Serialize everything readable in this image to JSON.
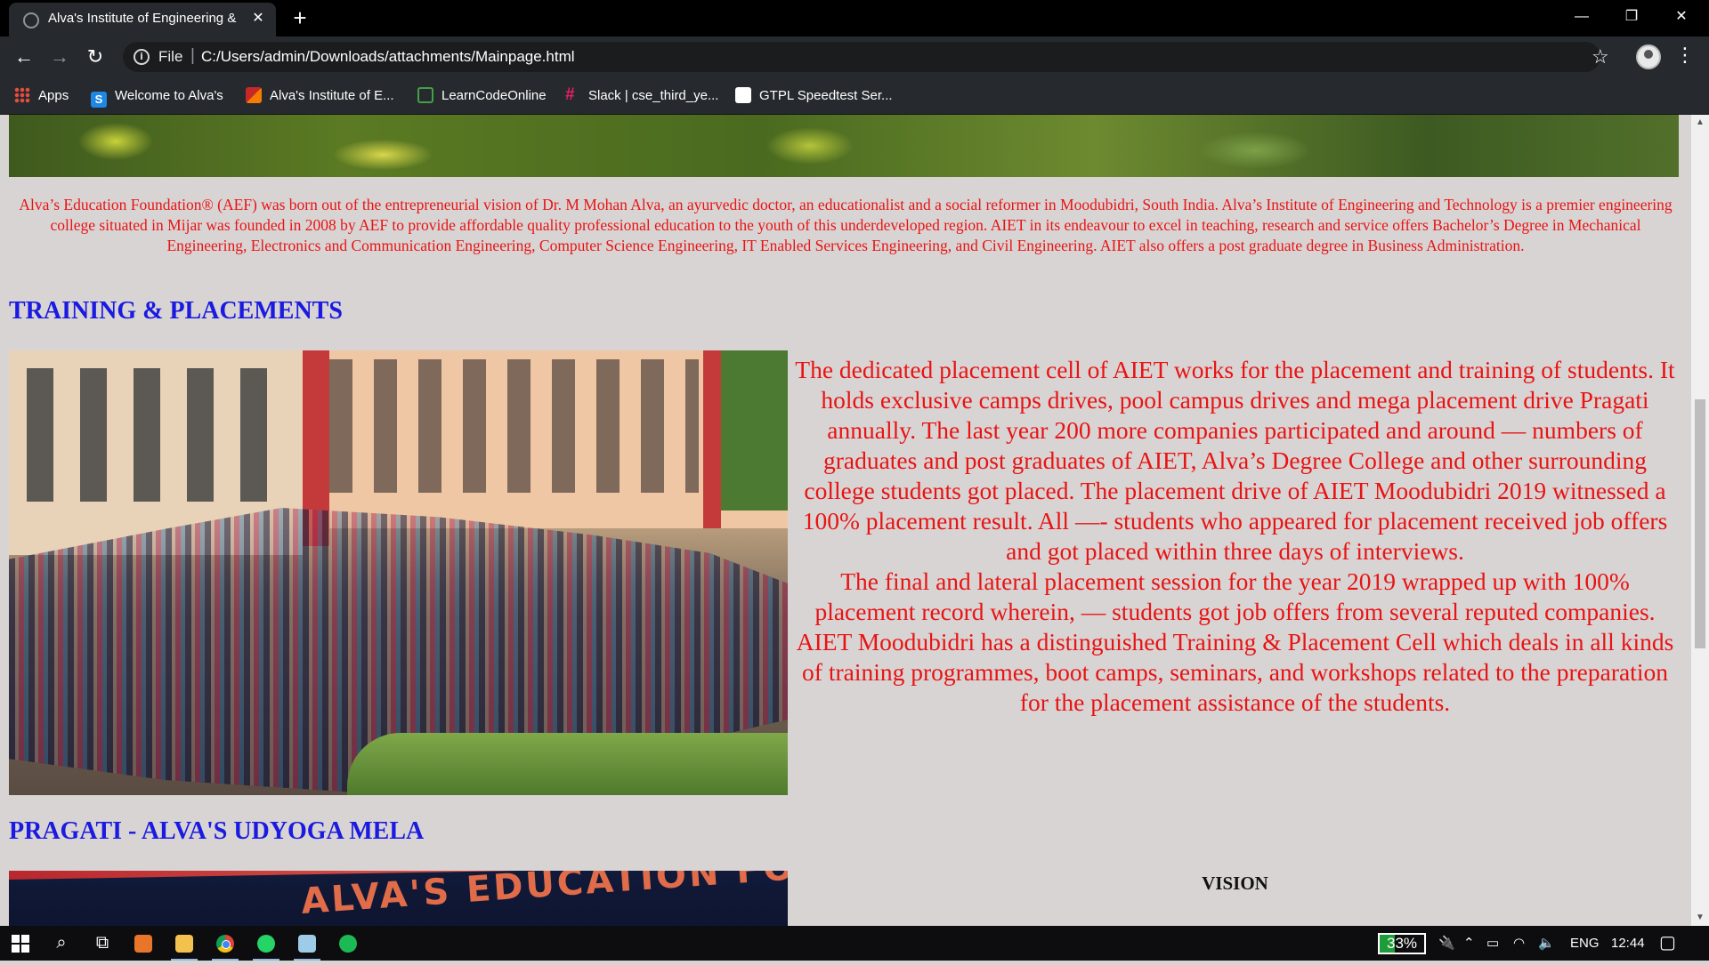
{
  "browser": {
    "tab_title": "Alva's Institute of Engineering &",
    "scheme_label": "File",
    "url": "C:/Users/admin/Downloads/attachments/Mainpage.html",
    "bookmarks": [
      {
        "label": "Apps",
        "icon": "apps-grid-icon"
      },
      {
        "label": "Welcome to Alva's",
        "icon": "s-logo-icon"
      },
      {
        "label": "Alva's Institute of E...",
        "icon": "alva-logo-icon"
      },
      {
        "label": "LearnCodeOnline",
        "icon": "lco-logo-icon"
      },
      {
        "label": "Slack | cse_third_ye...",
        "icon": "slack-icon"
      },
      {
        "label": "GTPL Speedtest Ser...",
        "icon": "gtpl-icon"
      }
    ]
  },
  "page": {
    "intro": "Alva’s Education Foundation® (AEF) was born out of the entrepreneurial vision of Dr. M Mohan Alva, an ayurvedic doctor, an educationalist and a social reformer in Moodubidri, South India. Alva’s Institute of Engineering and Technology is a premier engineering college situated in Mijar was founded in 2008 by AEF to provide affordable quality professional education to the youth of this underdeveloped region. AIET in its endeavour to excel in teaching, research and service offers Bachelor’s Degree in Mechanical Engineering, Electronics and Communication Engineering, Computer Science Engineering, IT Enabled Services Engineering, and Civil Engineering. AIET also offers a post graduate degree in Business Administration.",
    "training_heading": "TRAINING & PLACEMENTS",
    "placement_para1": "The dedicated placement cell of AIET works for the placement and training of students. It holds exclusive camps drives, pool campus drives and mega placement drive Pragati annually. The last year 200 more companies participated and around — numbers of graduates and post graduates of AIET, Alva’s Degree College and other surrounding college students got placed. The placement drive of AIET Moodubidri 2019 witnessed a 100% placement result. All —- students who appeared for placement received job offers and got placed within three days of interviews.",
    "placement_para2": "The final and lateral placement session for the year 2019 wrapped up with 100% placement record wherein, — students got job offers from several reputed companies. AIET Moodubidri has a distinguished Training & Placement Cell which deals in all kinds of training programmes, boot camps, seminars, and workshops related to the preparation for the placement assistance of the students.",
    "pragati_heading": "PRAGATI - ALVA'S UDYOGA MELA",
    "pragati_sign": "ALVA'S EDUCATION FO",
    "vision_title": "VISION"
  },
  "taskbar": {
    "battery_percent": 33,
    "battery_label": "33%",
    "language": "ENG",
    "time": "12:44"
  },
  "colors": {
    "body_text": "#e81313",
    "heading": "#1a1ae0",
    "page_bg": "#d9d4d4"
  }
}
